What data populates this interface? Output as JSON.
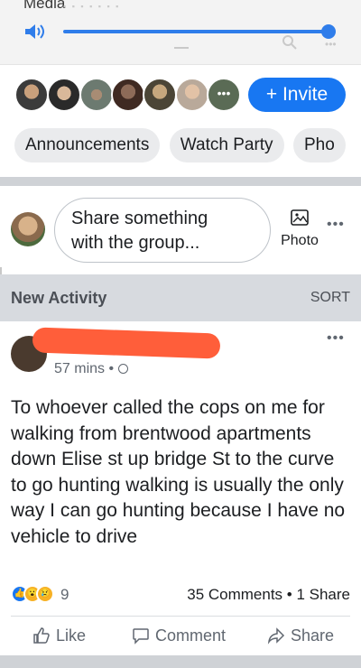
{
  "media": {
    "title": "Media",
    "volume_level": 0.98
  },
  "members": {
    "invite_label": "+ Invite",
    "more_label": "•••"
  },
  "pills": [
    "Announcements",
    "Watch Party",
    "Pho"
  ],
  "composer": {
    "placeholder_line1": "Share something",
    "placeholder_line2": "with the group...",
    "photo_label": "Photo",
    "more": "•••"
  },
  "activity": {
    "title": "New Activity",
    "sort_label": "SORT"
  },
  "post": {
    "time": "57 mins •",
    "more": "•••",
    "text": "To whoever called the cops on me for walking from brentwood apartments down Elise st up bridge St to the curve to go hunting walking is usually the only way I can go hunting because I have no vehicle to drive",
    "reaction_count": "9",
    "engagement": "35 Comments • 1 Share",
    "actions": {
      "like": "Like",
      "comment": "Comment",
      "share": "Share"
    }
  },
  "colors": {
    "accent": "#1877f2",
    "redaction": "#ff5e3a"
  }
}
